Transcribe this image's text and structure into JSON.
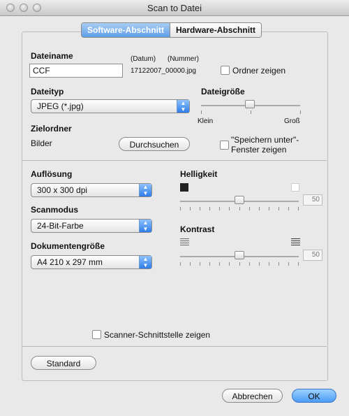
{
  "window": {
    "title": "Scan to Datei"
  },
  "tabs": {
    "software": "Software-Abschnitt",
    "hardware": "Hardware-Abschnitt"
  },
  "file": {
    "name_label": "Dateiname",
    "name_value": "CCF",
    "date_label": "(Datum)",
    "number_label": "(Nummer)",
    "generated_name": "17122007_00000.jpg",
    "show_folder_label": "Ordner zeigen",
    "type_label": "Dateityp",
    "type_value": "JPEG (*.jpg)",
    "size_label": "Dateigröße",
    "size_min": "Klein",
    "size_max": "Groß",
    "size_level": 0.5
  },
  "target": {
    "label": "Zielordner",
    "value": "Bilder",
    "browse_button": "Durchsuchen",
    "save_as_line1": "\"Speichern unter\"-",
    "save_as_line2": "Fenster zeigen"
  },
  "scan": {
    "resolution_label": "Auflösung",
    "resolution_value": "300 x 300 dpi",
    "mode_label": "Scanmodus",
    "mode_value": "24-Bit-Farbe",
    "docsize_label": "Dokumentengröße",
    "docsize_value": "A4  210 x 297 mm",
    "brightness_label": "Helligkeit",
    "brightness_value": "50",
    "contrast_label": "Kontrast",
    "contrast_value": "50"
  },
  "footer": {
    "scanner_ui_label": "Scanner-Schnittstelle zeigen",
    "default_button": "Standard",
    "cancel_button": "Abbrechen",
    "ok_button": "OK"
  }
}
